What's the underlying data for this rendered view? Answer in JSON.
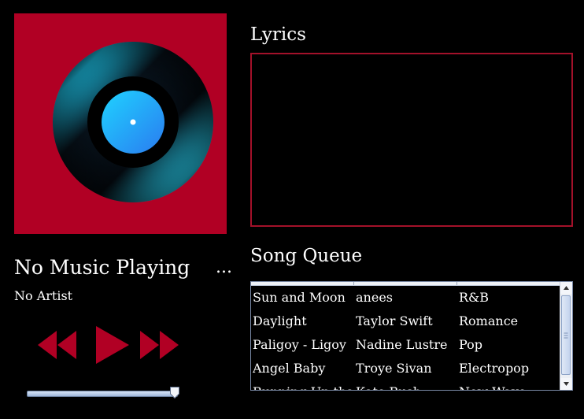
{
  "now_playing": {
    "title": "No Music Playing",
    "artist": "No Artist",
    "more_label": "...",
    "seek_position": 0.96
  },
  "controls": {
    "prev_icon": "rewind-icon",
    "play_icon": "play-icon",
    "next_icon": "fast-forward-icon"
  },
  "lyrics": {
    "title": "Lyrics",
    "text": ""
  },
  "queue": {
    "title": "Song Queue",
    "rows": [
      [
        "Sun and Moon",
        "anees",
        "R&B"
      ],
      [
        "Daylight",
        "Taylor Swift",
        "Romance"
      ],
      [
        "Paligoy - Ligoy",
        "Nadine Lustre",
        "Pop"
      ],
      [
        "Angel Baby",
        "Troye Sivan",
        "Electropop"
      ],
      [
        "Running Up that",
        "Kate Bush",
        "New Wave"
      ]
    ]
  },
  "colors": {
    "accent": "#b10024",
    "lyrics_border": "#a3112a",
    "background": "#000000"
  }
}
